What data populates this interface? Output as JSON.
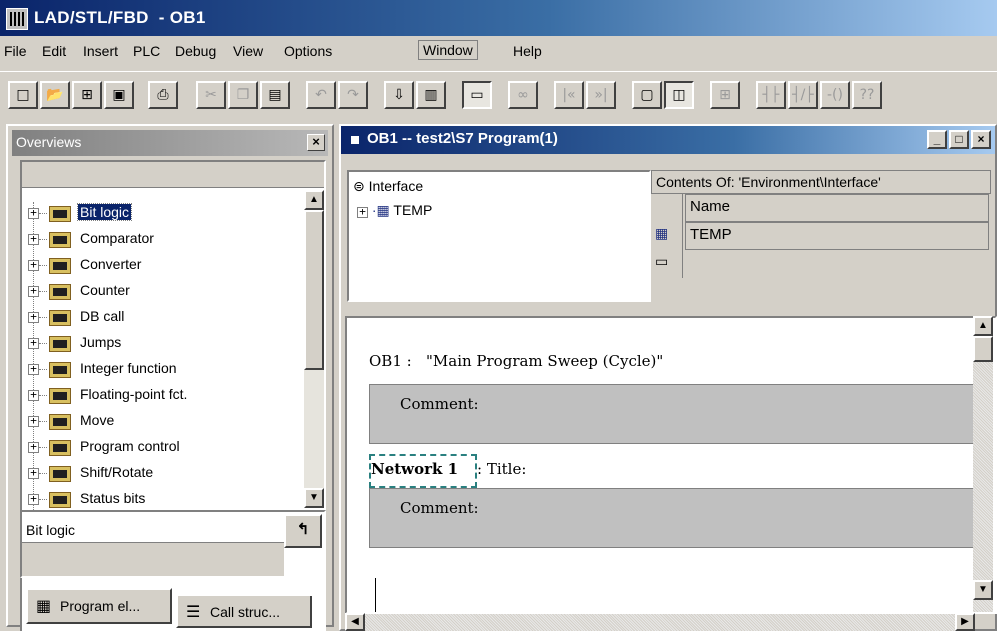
{
  "window": {
    "title": "LAD/STL/FBD  - OB1"
  },
  "menu": [
    "File",
    "Edit",
    "Insert",
    "PLC",
    "Debug",
    "View",
    "Options",
    "Window",
    "Help"
  ],
  "toolbar": {
    "buttons": [
      "new-icon",
      "open-icon",
      "accessible-nodes-icon",
      "save-icon",
      "print-icon",
      "cut-icon",
      "copy-icon",
      "paste-icon",
      "undo-icon",
      "redo-icon",
      "download-icon",
      "monitor-icon",
      "overview-icon",
      "glasses-icon",
      "first-network-icon",
      "last-network-icon",
      "lad-view-icon",
      "stl-view-icon",
      "branch-icon",
      "contact-no-icon",
      "contact-nc-icon",
      "coil-icon",
      "box-icon"
    ]
  },
  "overviews": {
    "title": "Overviews",
    "items": [
      {
        "label": "Bit logic",
        "selected": true
      },
      {
        "label": "Comparator"
      },
      {
        "label": "Converter"
      },
      {
        "label": "Counter"
      },
      {
        "label": "DB call"
      },
      {
        "label": "Jumps"
      },
      {
        "label": "Integer function"
      },
      {
        "label": "Floating-point fct."
      },
      {
        "label": "Move"
      },
      {
        "label": "Program control"
      },
      {
        "label": "Shift/Rotate"
      },
      {
        "label": "Status bits"
      }
    ],
    "description": "Bit logic",
    "tabs": [
      {
        "label": "Program el...",
        "active": true
      },
      {
        "label": "Call struc..."
      }
    ]
  },
  "editor": {
    "title": "OB1 -- test2\\S7 Program(1)",
    "interface": {
      "root": "Interface",
      "child": "TEMP"
    },
    "contents": {
      "header": "Contents Of: 'Environment\\Interface'",
      "column": "Name",
      "rows": [
        "TEMP"
      ]
    },
    "block_line": "OB1 :   \"Main Program Sweep (Cycle)\"",
    "comment_label": "Comment:",
    "network_label": "Network 1",
    "network_title": ": Title:"
  }
}
